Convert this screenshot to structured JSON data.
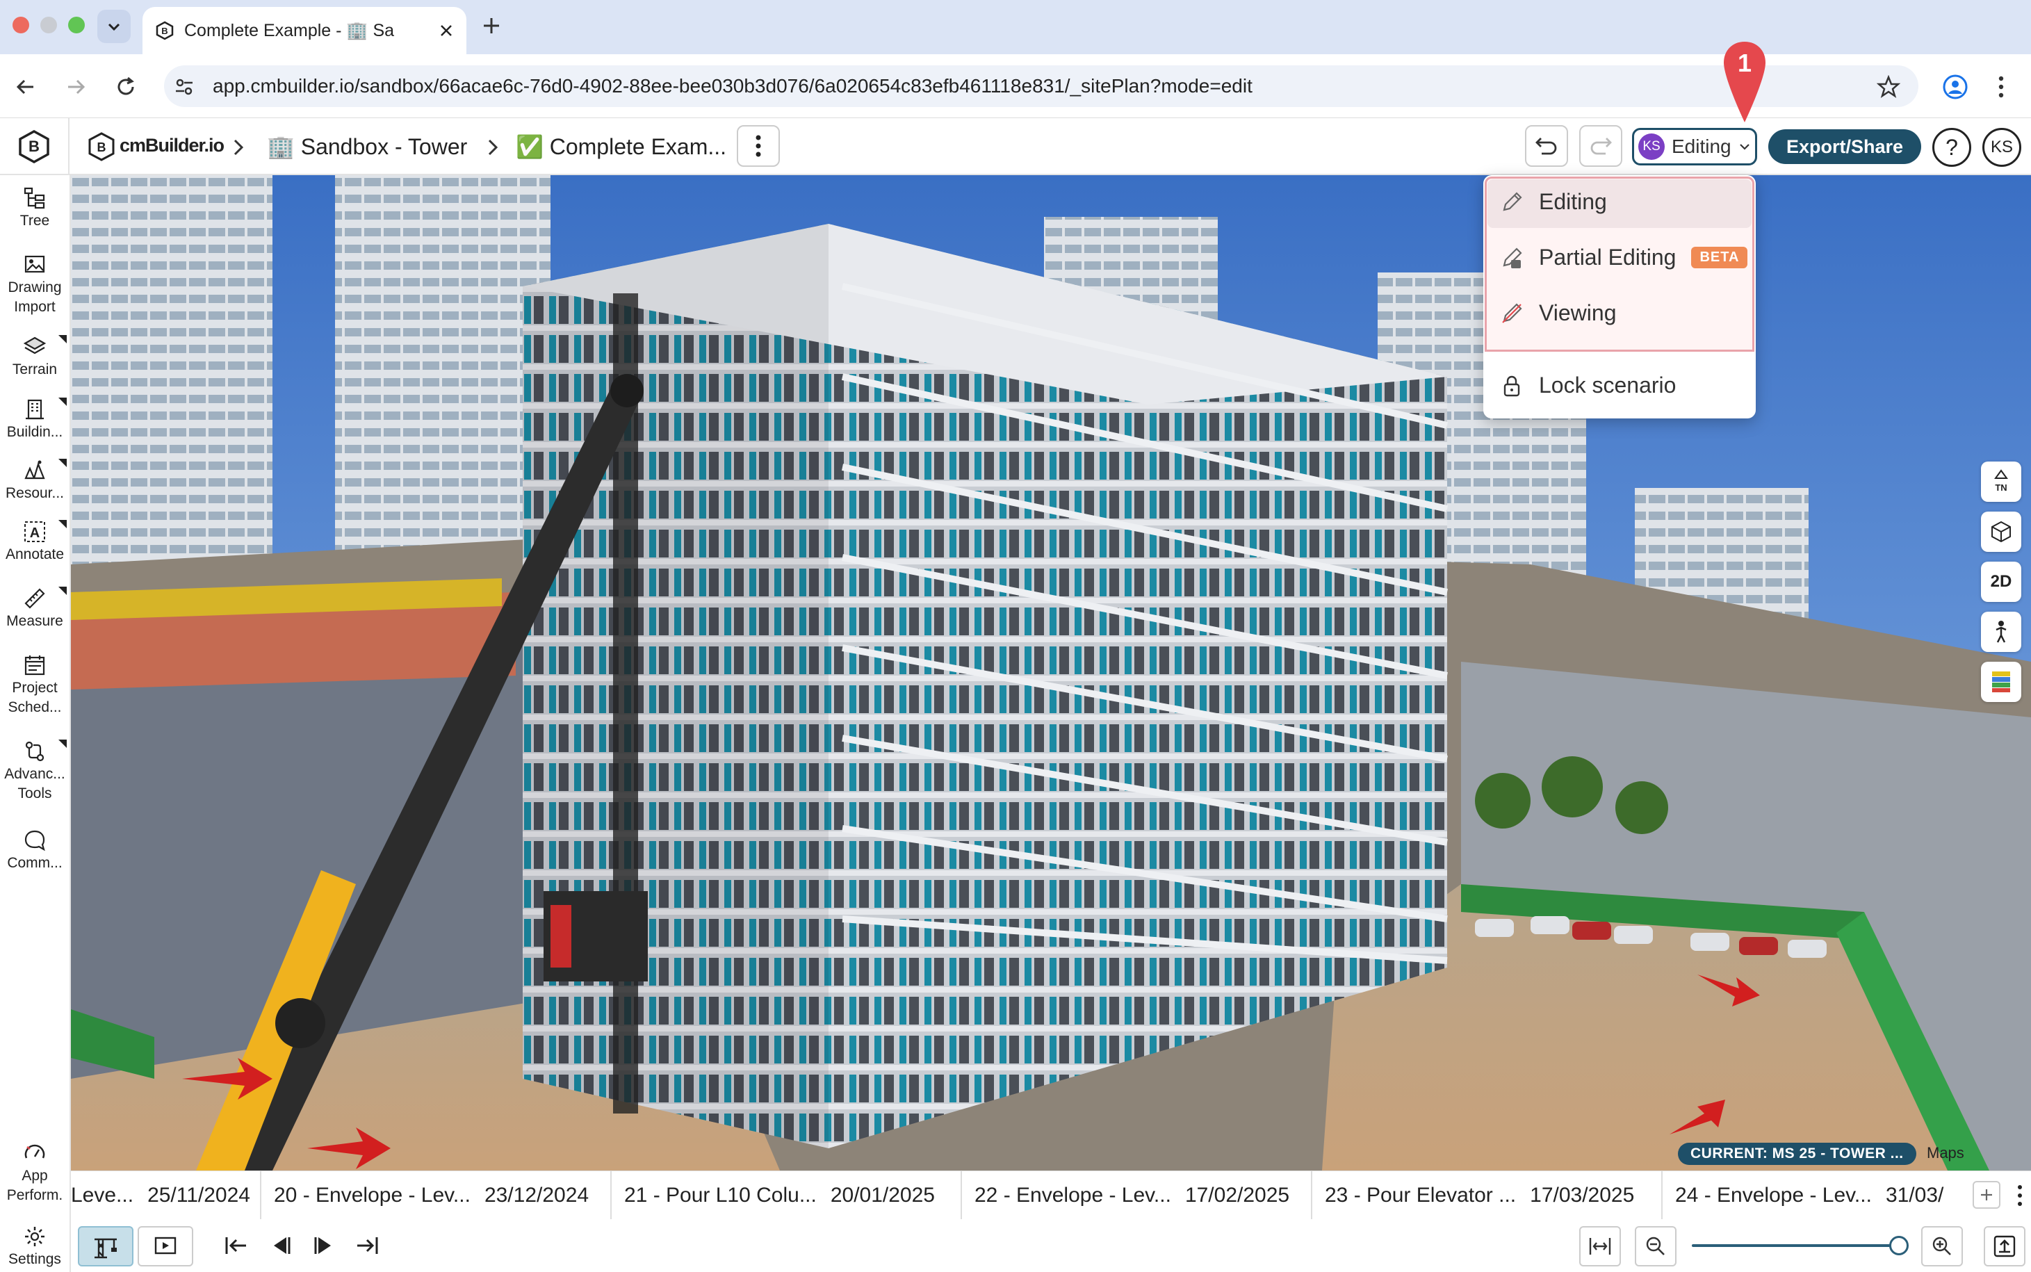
{
  "browser": {
    "tab_title": "Complete Example - 🏢 Sa",
    "url": "app.cmbuilder.io/sandbox/66acae6c-76d0-4902-88ee-bee030b3d076/6a020654c83efb461118e831/_sitePlan?mode=edit"
  },
  "header": {
    "logo": "cmBuilder.io",
    "breadcrumb_project": "🏢 Sandbox - Tower",
    "breadcrumb_scenario": "✅ Complete Exam...",
    "mode_avatar": "KS",
    "mode_label": "Editing",
    "export_label": "Export/Share",
    "help_label": "?",
    "user_initials": "KS",
    "callout_number": "1"
  },
  "sidebar": {
    "items": [
      {
        "label": "Tree",
        "icon": "tree-icon"
      },
      {
        "label": "Drawing Import",
        "icon": "image-icon"
      },
      {
        "label": "Terrain",
        "icon": "terrain-icon"
      },
      {
        "label": "Buildin...",
        "icon": "building-icon"
      },
      {
        "label": "Resour...",
        "icon": "resources-icon"
      },
      {
        "label": "Annotate",
        "icon": "annotate-icon"
      },
      {
        "label": "Measure",
        "icon": "ruler-icon"
      },
      {
        "label": "Project Sched...",
        "icon": "calendar-icon"
      },
      {
        "label": "Advanc... Tools",
        "icon": "tools-icon"
      },
      {
        "label": "Comm...",
        "icon": "comment-icon"
      }
    ],
    "bottom": [
      {
        "label": "App Perform.",
        "icon": "gauge-icon"
      },
      {
        "label": "Settings",
        "icon": "settings-icon"
      }
    ]
  },
  "dropdown": {
    "items": [
      {
        "label": "Editing",
        "icon": "pencil-icon"
      },
      {
        "label": "Partial Editing",
        "icon": "partial-edit-icon",
        "badge": "BETA"
      },
      {
        "label": "Viewing",
        "icon": "pencil-off-icon"
      }
    ],
    "lock_label": "Lock scenario"
  },
  "scene": {
    "current_badge": "CURRENT: MS 25 - TOWER ...",
    "maps_credit": "Maps",
    "view_2d": "2D",
    "north_label": "TN"
  },
  "timeline": {
    "segments": [
      {
        "name": "Leve...",
        "date": "25/11/2024"
      },
      {
        "name": "20 - Envelope - Lev...",
        "date": "23/12/2024"
      },
      {
        "name": "21 - Pour L10 Colu...",
        "date": "20/01/2025"
      },
      {
        "name": "22 - Envelope - Lev...",
        "date": "17/02/2025"
      },
      {
        "name": "23 - Pour Elevator ...",
        "date": "17/03/2025"
      },
      {
        "name": "24 - Envelope - Lev...",
        "date": "31/03/"
      }
    ]
  },
  "zoom": {
    "level": 1.0
  },
  "colors": {
    "accent": "#1e4f68",
    "mode_avatar": "#7b3fc4",
    "highlight_border": "#e9a3aa",
    "callout": "#e5484d",
    "badge": "#f08a54"
  }
}
